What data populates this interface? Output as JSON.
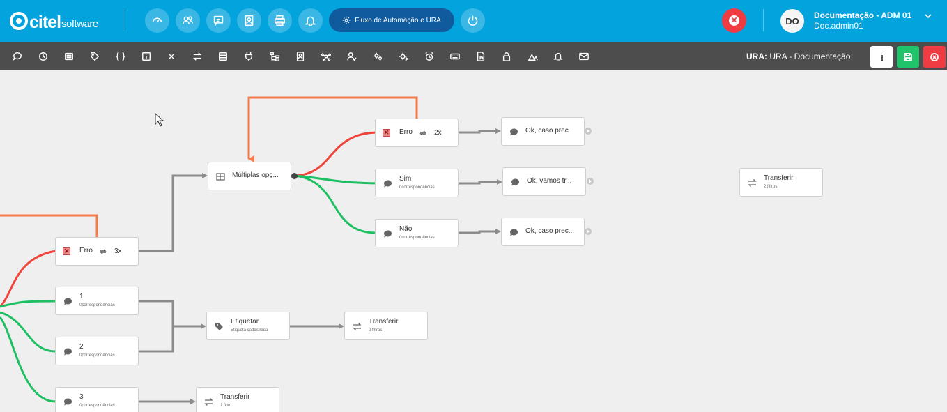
{
  "header": {
    "logo_brand": "citel",
    "logo_sub": "software",
    "nav_icons": [
      "dashboard-icon",
      "users-icon",
      "chat-icon",
      "contacts-icon",
      "printer-icon",
      "bell-icon"
    ],
    "flow_button_label": "Fluxo de Automação e URA",
    "power_icon": "power-icon",
    "avatar_initials": "DO",
    "user_name": "Documentação - ADM 01",
    "user_login": "Doc.admin01"
  },
  "toolbar": {
    "tools": [
      "message-icon",
      "clock-icon",
      "list-icon",
      "tag-icon",
      "braces-icon",
      "info-box-icon",
      "close-icon",
      "transfer-icon",
      "form-icon",
      "plug-icon",
      "tree-icon",
      "contact-card-icon",
      "network-icon",
      "user-check-icon",
      "gears-icon",
      "gear-play-icon",
      "alarm-icon",
      "keyboard-icon",
      "js-icon",
      "lock-icon",
      "shapes-icon",
      "bell-icon",
      "mail-icon"
    ],
    "ura_prefix": "URA:",
    "ura_name": "URA - Documentação"
  },
  "colors": {
    "header_bg": "#03a3dd",
    "toolbar_bg": "#4d4d4d",
    "error_link": "#f0433a",
    "success_link": "#1dbf62",
    "default_link": "#8c8c8c",
    "retry_link": "#f47a4b"
  },
  "nodes": {
    "erro_3x": {
      "label": "Erro",
      "count": "3x"
    },
    "opt_1": {
      "label": "1",
      "sub": "0correspondências"
    },
    "opt_2": {
      "label": "2",
      "sub": "0correspondências"
    },
    "opt_3": {
      "label": "3",
      "sub": "0correspondências"
    },
    "multiplas": {
      "label": "Múltiplas opç..."
    },
    "etiquetar": {
      "label": "Etiquetar",
      "sub": "Etiqueta cadastrada"
    },
    "transferir_a": {
      "label": "Transferir",
      "sub": "2 filtros"
    },
    "transferir_b": {
      "label": "Transferir",
      "sub": "1 filtro"
    },
    "transferir_c": {
      "label": "Transferir",
      "sub": "2 filtros"
    },
    "erro_2x": {
      "label": "Erro",
      "count": "2x"
    },
    "sim": {
      "label": "Sim",
      "sub": "0correspondências"
    },
    "nao": {
      "label": "Não",
      "sub": "0correspondências"
    },
    "ok_caso_1": {
      "label": "Ok, caso prec..."
    },
    "ok_vamos": {
      "label": "Ok, vamos tr..."
    },
    "ok_caso_2": {
      "label": "Ok, caso prec..."
    }
  }
}
